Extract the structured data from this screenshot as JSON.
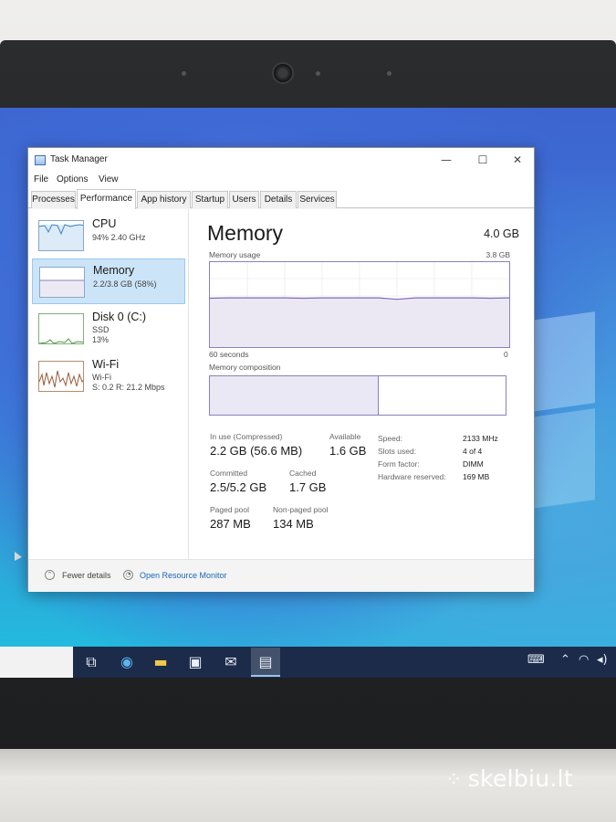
{
  "window": {
    "title": "Task Manager",
    "controls": {
      "minimize": "—",
      "maximize": "☐",
      "close": "✕"
    }
  },
  "menu": [
    "File",
    "Options",
    "View"
  ],
  "tabs": [
    "Processes",
    "Performance",
    "App history",
    "Startup",
    "Users",
    "Details",
    "Services"
  ],
  "active_tab": "Performance",
  "sidebar": {
    "items": [
      {
        "name": "CPU",
        "line1": "94%  2.40 GHz",
        "line2": ""
      },
      {
        "name": "Memory",
        "line1": "2.2/3.8 GB (58%)",
        "line2": ""
      },
      {
        "name": "Disk 0 (C:)",
        "line1": "SSD",
        "line2": "13%"
      },
      {
        "name": "Wi-Fi",
        "line1": "Wi-Fi",
        "line2": "S: 0.2  R: 21.2 Mbps"
      }
    ],
    "selected_index": 1
  },
  "memory": {
    "title": "Memory",
    "total": "4.0 GB",
    "usage_label": "Memory usage",
    "usage_max": "3.8 GB",
    "time_left": "60 seconds",
    "time_right": "0",
    "composition_label": "Memory composition",
    "usage_fraction": 0.58,
    "stats": {
      "in_use_label": "In use (Compressed)",
      "in_use_value": "2.2 GB (56.6 MB)",
      "available_label": "Available",
      "available_value": "1.6 GB",
      "committed_label": "Committed",
      "committed_value": "2.5/5.2 GB",
      "cached_label": "Cached",
      "cached_value": "1.7 GB",
      "paged_label": "Paged pool",
      "paged_value": "287 MB",
      "nonpaged_label": "Non-paged pool",
      "nonpaged_value": "134 MB"
    },
    "specs": {
      "speed_label": "Speed:",
      "speed_value": "2133 MHz",
      "slots_label": "Slots used:",
      "slots_value": "4 of 4",
      "form_label": "Form factor:",
      "form_value": "DIMM",
      "hw_label": "Hardware reserved:",
      "hw_value": "169 MB"
    }
  },
  "footer": {
    "fewer_details": "Fewer details",
    "resource_monitor": "Open Resource Monitor"
  },
  "taskbar": {
    "icons": [
      "task-view-icon",
      "edge-icon",
      "file-explorer-icon",
      "store-icon",
      "mail-icon",
      "task-manager-icon"
    ],
    "tray": [
      "keyboard-icon",
      "chevron-up-icon",
      "wifi-icon",
      "volume-icon"
    ]
  },
  "watermark": "skelbiu.lt",
  "colors": {
    "accent": "#8b7fbd",
    "selection": "#cce4f7",
    "taskbar": "#1c2b4a"
  }
}
